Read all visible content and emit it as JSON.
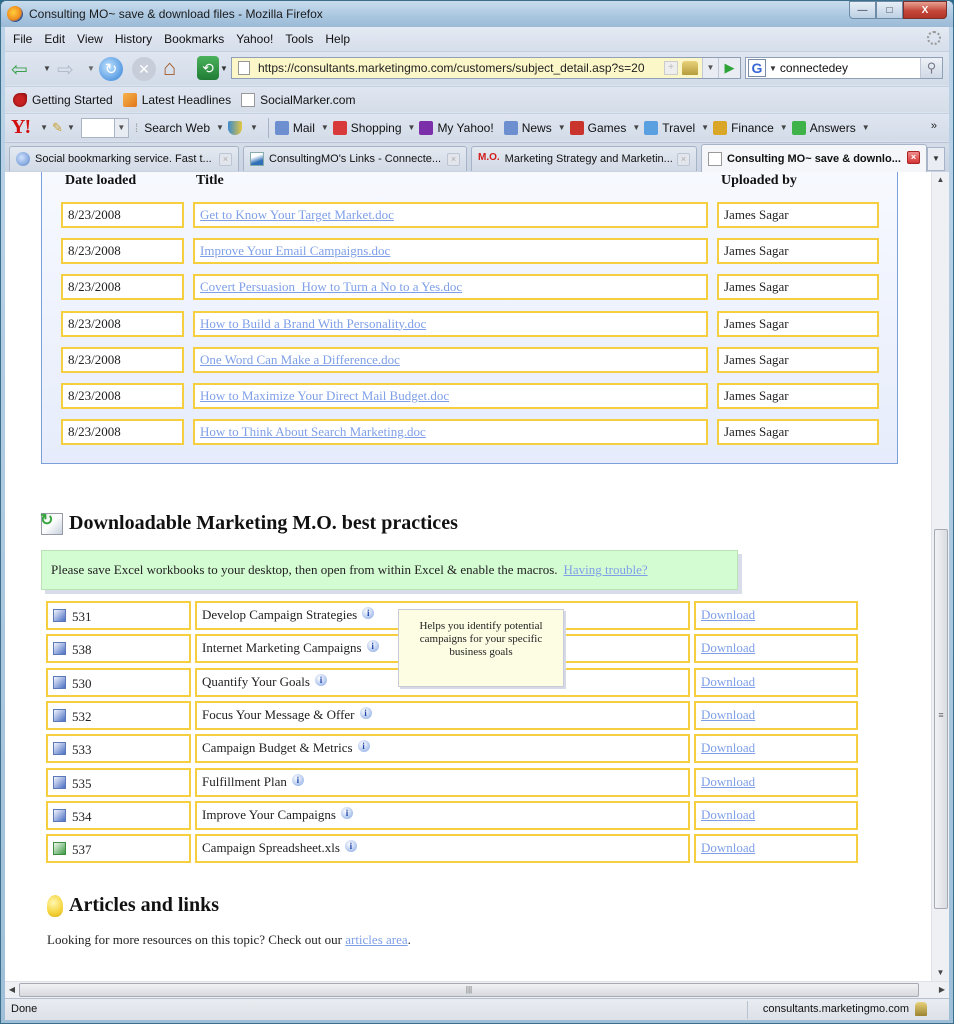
{
  "window": {
    "title": "Consulting MO~ save & download files - Mozilla Firefox",
    "minimize": "—",
    "maximize": "□",
    "close": "X"
  },
  "menu": [
    "File",
    "Edit",
    "View",
    "History",
    "Bookmarks",
    "Yahoo!",
    "Tools",
    "Help"
  ],
  "navbar": {
    "url": "https://consultants.marketingmo.com/customers/subject_detail.asp?s=20",
    "search_engine": "G",
    "search_value": "connectedey"
  },
  "bookmarks": [
    {
      "label": "Getting Started",
      "icon": "getting-started-icon"
    },
    {
      "label": "Latest Headlines",
      "icon": "rss-icon"
    },
    {
      "label": "SocialMarker.com",
      "icon": "page-icon"
    }
  ],
  "yahoo_toolbar": {
    "logo": "Y!",
    "search_web": "Search Web",
    "items": [
      {
        "label": "Mail",
        "icon": "mail-icon",
        "color": "#6d8fd0"
      },
      {
        "label": "Shopping",
        "icon": "shopping-bag-icon",
        "color": "#d8393a"
      },
      {
        "label": "My Yahoo!",
        "icon": "my-yahoo-icon",
        "color": "#7b2fa8"
      },
      {
        "label": "News",
        "icon": "news-icon",
        "color": "#6d8fd0"
      },
      {
        "label": "Games",
        "icon": "games-dice-icon",
        "color": "#c9352c"
      },
      {
        "label": "Travel",
        "icon": "travel-icon",
        "color": "#5aa0e0"
      },
      {
        "label": "Finance",
        "icon": "finance-icon",
        "color": "#d9a628"
      },
      {
        "label": "Answers",
        "icon": "answers-icon",
        "color": "#3fb34a"
      }
    ],
    "more": "»"
  },
  "tabs": [
    {
      "label": "Social bookmarking service. Fast t...",
      "active": false
    },
    {
      "label": "ConsultingMO's Links - Connecte...",
      "active": false
    },
    {
      "label": "Marketing Strategy and Marketin...",
      "active": false
    },
    {
      "label": "Consulting MO~ save & downlo...",
      "active": true
    }
  ],
  "files_table": {
    "headers": {
      "date": "Date loaded",
      "title": "Title",
      "uploader": "Uploaded by"
    },
    "rows": [
      {
        "date": "8/23/2008",
        "title": "Get to Know Your Target Market.doc",
        "uploader": "James Sagar"
      },
      {
        "date": "8/23/2008",
        "title": "Improve Your Email Campaigns.doc",
        "uploader": "James Sagar"
      },
      {
        "date": "8/23/2008",
        "title": "Covert Persuasion_How to Turn a No to a Yes.doc",
        "uploader": "James Sagar"
      },
      {
        "date": "8/23/2008",
        "title": "How to Build a Brand With Personality.doc",
        "uploader": "James Sagar"
      },
      {
        "date": "8/23/2008",
        "title": "One Word Can Make a Difference.doc",
        "uploader": "James Sagar"
      },
      {
        "date": "8/23/2008",
        "title": "How to Maximize Your Direct Mail Budget.doc",
        "uploader": "James Sagar"
      },
      {
        "date": "8/23/2008",
        "title": "How to Think About Search Marketing.doc",
        "uploader": "James Sagar"
      }
    ]
  },
  "best_practices": {
    "heading": "Downloadable Marketing M.O. best practices",
    "notice": "Please save Excel workbooks to your desktop, then open from within Excel & enable the macros.",
    "notice_link": "Having trouble?",
    "download_label": "Download",
    "items": [
      {
        "id": "531",
        "type": "doc",
        "title": "Develop Campaign Strategies"
      },
      {
        "id": "538",
        "type": "doc",
        "title": "Internet Marketing Campaigns"
      },
      {
        "id": "530",
        "type": "doc",
        "title": "Quantify Your Goals"
      },
      {
        "id": "532",
        "type": "doc",
        "title": "Focus Your Message & Offer"
      },
      {
        "id": "533",
        "type": "doc",
        "title": "Campaign Budget & Metrics"
      },
      {
        "id": "535",
        "type": "doc",
        "title": "Fulfillment Plan"
      },
      {
        "id": "534",
        "type": "doc",
        "title": "Improve Your Campaigns"
      },
      {
        "id": "537",
        "type": "xls",
        "title": "Campaign Spreadsheet.xls"
      }
    ],
    "tooltip": "Helps you identify potential campaigns for your specific business goals"
  },
  "articles": {
    "heading": "Articles and links",
    "text": "Looking for more resources on this topic? Check out our",
    "link": "articles area",
    "suffix": "."
  },
  "status": {
    "text": "Done",
    "host": "consultants.marketingmo.com"
  },
  "colors": {
    "cell_border": "#f5cf3f",
    "link": "#7e9fe8",
    "notice_bg": "#d4fcd2",
    "tooltip_bg": "#fdfde4",
    "panel_border": "#7b9fd8"
  }
}
